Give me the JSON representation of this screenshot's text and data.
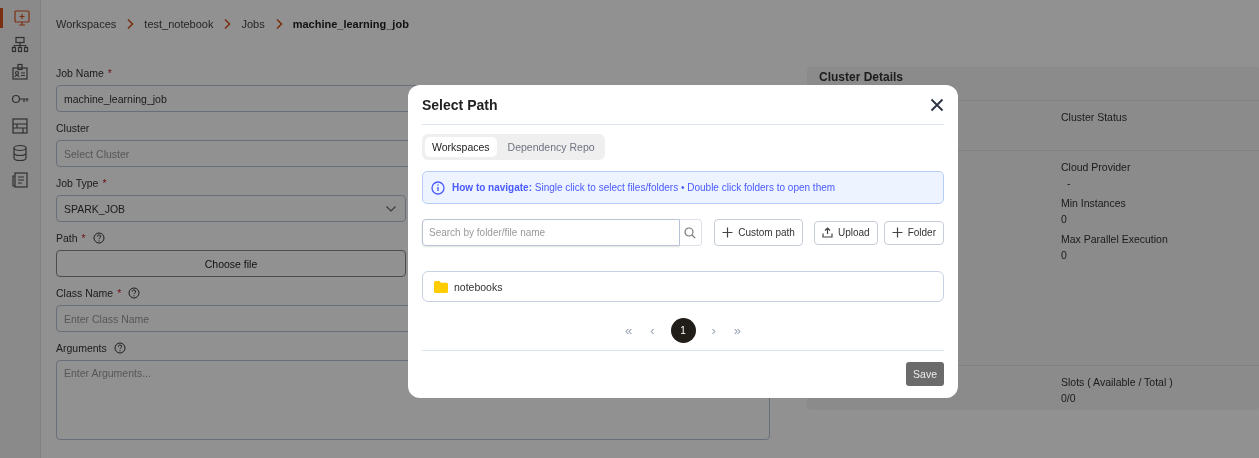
{
  "sidebar": {
    "items": [
      {
        "selected": true
      },
      {
        "selected": false
      },
      {
        "selected": false
      },
      {
        "selected": false
      },
      {
        "selected": false
      },
      {
        "selected": false
      },
      {
        "selected": false
      }
    ]
  },
  "breadcrumb": [
    {
      "label": "Workspaces",
      "current": false
    },
    {
      "label": "test_notebook",
      "current": false
    },
    {
      "label": "Jobs",
      "current": false
    },
    {
      "label": "machine_learning_job",
      "current": true
    }
  ],
  "form": {
    "fields": [
      {
        "kind": "input",
        "label": "Job Name",
        "required_mark": "*",
        "help": false,
        "value": "machine_learning_job"
      },
      {
        "kind": "input",
        "label": "Cluster",
        "help": false,
        "placeholder": "Select Cluster"
      },
      {
        "kind": "select",
        "label": "Job Type",
        "required_mark": "*",
        "help": false,
        "value": "SPARK_JOB"
      },
      {
        "kind": "file",
        "label": "Path",
        "required_mark": "*",
        "help": true,
        "button": "Choose file"
      },
      {
        "kind": "input",
        "label": "Class Name",
        "required_mark": "*",
        "help": true,
        "placeholder": "Enter Class Name"
      },
      {
        "kind": "textarea",
        "label": "Arguments",
        "help": true,
        "placeholder": "Enter Arguments..."
      }
    ]
  },
  "cluster_panel": {
    "title": "Cluster Details",
    "rows": [
      {
        "items": [
          {
            "label": "Cluster Status"
          }
        ]
      },
      {
        "items": [
          {
            "label": "Cloud Provider",
            "value": "-"
          },
          {
            "label": "Min Instances",
            "value": "0"
          },
          {
            "label": "Max Parallel Execution",
            "value": "0"
          }
        ]
      },
      {
        "items": [
          {
            "label": "Slots ( Available / Total )",
            "value": "0/0"
          }
        ]
      }
    ]
  },
  "dialog": {
    "title": "Select Path",
    "tabs": [
      {
        "label": "Workspaces",
        "selected": true
      },
      {
        "label": "Dependency Repo",
        "selected": false
      }
    ],
    "info": "**How to navigate:** Single click to select files/folders • Double click folders to open them",
    "search": {
      "placeholder": "Search by folder/file name"
    },
    "actions": [
      {
        "kind": "plus",
        "label": "Custom path"
      },
      {
        "kind": "upload",
        "label": "Upload"
      },
      {
        "kind": "plus",
        "label": "Folder"
      }
    ],
    "items": [
      {
        "kind": "folder",
        "name": "notebooks"
      }
    ],
    "pagination": {
      "first": "«",
      "prev": "‹",
      "pages": [
        {
          "label": "1",
          "selected": true
        }
      ],
      "next": "›",
      "last": "»"
    },
    "save": {
      "label": "Save",
      "disabled": true
    }
  }
}
